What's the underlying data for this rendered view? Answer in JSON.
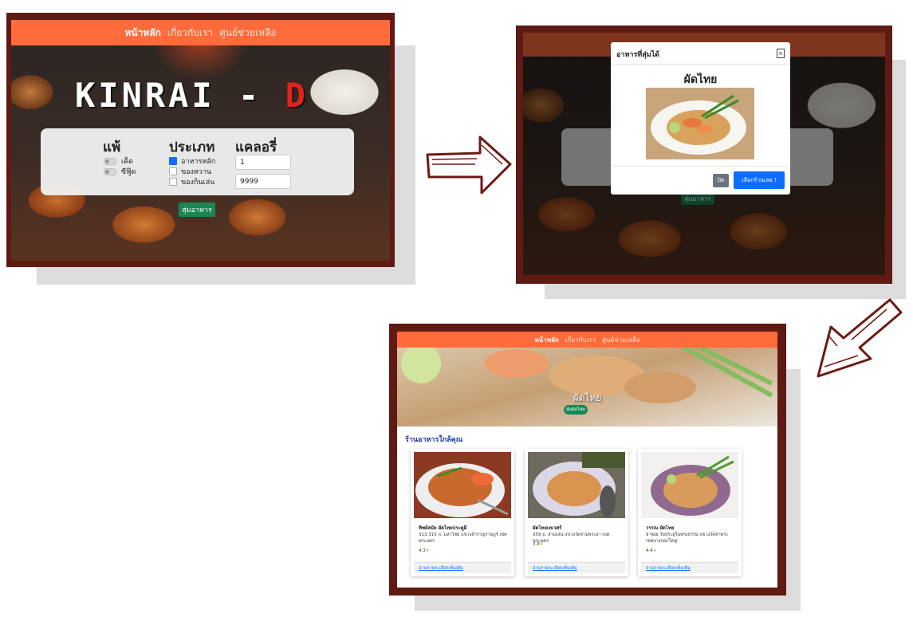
{
  "nav": {
    "home": "หน้าหลัก",
    "about": "เกี่ยวกับเรา",
    "help": "ศูนย์ช่วยเหลือ"
  },
  "screen1": {
    "logo_main": "KINRAI -",
    "logo_accent": "D",
    "allergy": {
      "title": "แพ้",
      "options": [
        "เค็ด",
        "ซีฟู๊ด"
      ]
    },
    "category": {
      "title": "ประเภท",
      "options": [
        "อาหารหลัก",
        "ของหวาน",
        "ของกินเล่น"
      ],
      "checked": [
        true,
        false,
        false
      ]
    },
    "calorie": {
      "title": "แคลอรี่",
      "min_value": "1",
      "max_value": "9999"
    },
    "random_button": "สุ่มอาหาร"
  },
  "screen2": {
    "modal_title": "อาหารที่สุ่มได้",
    "close_symbol": "×",
    "food_name": "ผัดไทย",
    "close_button": "ปิด",
    "choose_button": "เลือกร้านเลย !",
    "behind_button": "สุ่มอาหาร"
  },
  "screen3": {
    "hero_title": "ผัดไทย",
    "hero_button": "สุ่มต่อไหม",
    "section_title": "ร้านอาหารใกล้คุณ",
    "cards": [
      {
        "name": "ทิพย์สมัย ผัดไทยประตูผี",
        "address": "313 315 ถ. มหาไชย แขวงสำราญราษฎร์ เขตพระนคร",
        "rating": "4.3",
        "link": "อ่านรายละเอียดเพิ่มเติม"
      },
      {
        "name": "ผัดไทยเทเวศร์",
        "address": "359 ถ. สามเสน แขวงวัดสามพระยา เขตพระนคร",
        "rating": "3.9",
        "link": "อ่านรายละเอียดเพิ่มเติม"
      },
      {
        "name": "วรรณ ผัดไทย",
        "address": "9 ซอย วัดประดู่ในทรงธรรม แขวงวัดท่าพระ เขตบางกอกใหญ่",
        "rating": "4.4",
        "link": "อ่านรายละเอียดเพิ่มเติม"
      }
    ],
    "star": "★"
  },
  "colors": {
    "nav": "#ff6b3a",
    "frame": "#5f1a14",
    "primary": "#0d6efd",
    "success": "#198754",
    "secondary": "#6c757d"
  },
  "icons": [
    "right-arrow-icon",
    "down-left-arrow-icon",
    "star-icon",
    "close-icon"
  ]
}
